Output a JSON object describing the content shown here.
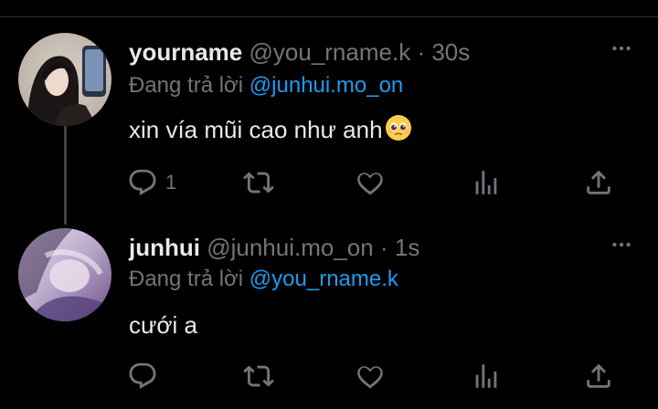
{
  "tweets": [
    {
      "name": "yourname",
      "handle": "@you_rname.k",
      "separator": "·",
      "time": "30s",
      "replying_prefix": "Đang trả lời",
      "replying_to": "@junhui.mo_on",
      "text": "xin vía mũi cao như anh",
      "emoji": "pleading-face",
      "reply_count": "1"
    },
    {
      "name": "junhui",
      "handle": "@junhui.mo_on",
      "separator": "·",
      "time": "1s",
      "replying_prefix": "Đang trả lời",
      "replying_to": "@you_rname.k",
      "text": "cưới a",
      "reply_count": ""
    }
  ],
  "icons": {
    "reply": "reply-icon",
    "retweet": "retweet-icon",
    "like": "heart-icon",
    "stats": "bar-chart-icon",
    "share": "share-icon",
    "more": "more-dots-icon"
  },
  "colors": {
    "background": "#000000",
    "text": "#e7e9ea",
    "secondary": "#71767b",
    "mention": "#1d9bf0",
    "thread_line": "#3e4144"
  }
}
